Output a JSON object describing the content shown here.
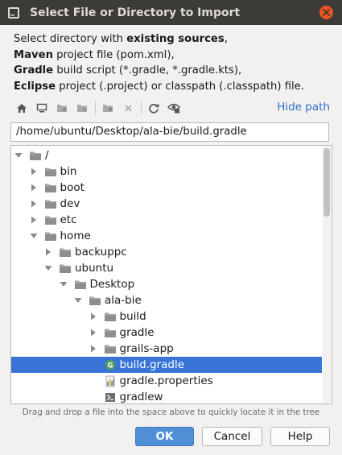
{
  "window": {
    "title": "Select File or Directory to Import",
    "icon": "intellij-app-icon",
    "close_icon": "close-icon"
  },
  "description": {
    "line1": {
      "prefix": "Select directory with ",
      "bold": "existing sources",
      "suffix": ","
    },
    "line2": {
      "bold": "Maven",
      "suffix": " project file (pom.xml),"
    },
    "line3": {
      "bold": "Gradle",
      "suffix": " build script (*.gradle, *.gradle.kts),"
    },
    "line4": {
      "bold": "Eclipse",
      "suffix": " project (.project) or classpath (.classpath) file."
    }
  },
  "toolbar": {
    "buttons": [
      "home-icon",
      "desktop-icon",
      "project-folder-icon",
      "module-folder-icon",
      "new-folder-icon",
      "delete-icon",
      "refresh-icon",
      "show-hidden-icon"
    ],
    "hide_path_label": "Hide path"
  },
  "path_field": {
    "value": "/home/ubuntu/Desktop/ala-bie/build.gradle"
  },
  "tree": {
    "items": [
      {
        "label": "/",
        "depth": 0,
        "expanded": true,
        "has_children": true,
        "type": "folder"
      },
      {
        "label": "bin",
        "depth": 1,
        "expanded": false,
        "has_children": true,
        "type": "folder"
      },
      {
        "label": "boot",
        "depth": 1,
        "expanded": false,
        "has_children": true,
        "type": "folder"
      },
      {
        "label": "dev",
        "depth": 1,
        "expanded": false,
        "has_children": true,
        "type": "folder"
      },
      {
        "label": "etc",
        "depth": 1,
        "expanded": false,
        "has_children": true,
        "type": "folder"
      },
      {
        "label": "home",
        "depth": 1,
        "expanded": true,
        "has_children": true,
        "type": "folder"
      },
      {
        "label": "backuppc",
        "depth": 2,
        "expanded": false,
        "has_children": true,
        "type": "folder"
      },
      {
        "label": "ubuntu",
        "depth": 2,
        "expanded": true,
        "has_children": true,
        "type": "folder"
      },
      {
        "label": "Desktop",
        "depth": 3,
        "expanded": true,
        "has_children": true,
        "type": "folder"
      },
      {
        "label": "ala-bie",
        "depth": 4,
        "expanded": true,
        "has_children": true,
        "type": "folder"
      },
      {
        "label": "build",
        "depth": 5,
        "expanded": false,
        "has_children": true,
        "type": "folder"
      },
      {
        "label": "gradle",
        "depth": 5,
        "expanded": false,
        "has_children": true,
        "type": "folder"
      },
      {
        "label": "grails-app",
        "depth": 5,
        "expanded": false,
        "has_children": true,
        "type": "folder"
      },
      {
        "label": "build.gradle",
        "depth": 5,
        "expanded": false,
        "has_children": false,
        "type": "gradle-file",
        "selected": true
      },
      {
        "label": "gradle.properties",
        "depth": 5,
        "expanded": false,
        "has_children": false,
        "type": "properties-file"
      },
      {
        "label": "gradlew",
        "depth": 5,
        "expanded": false,
        "has_children": false,
        "type": "script-file"
      }
    ]
  },
  "hint": "Drag and drop a file into the space above to quickly locate it in the tree",
  "buttons": {
    "ok": "OK",
    "cancel": "Cancel",
    "help": "Help"
  },
  "colors": {
    "titlebar": "#3c3b37",
    "selection": "#3875d6",
    "link": "#2f6fc8",
    "ok_button": "#4f8fd6",
    "close_button": "#e95420"
  }
}
